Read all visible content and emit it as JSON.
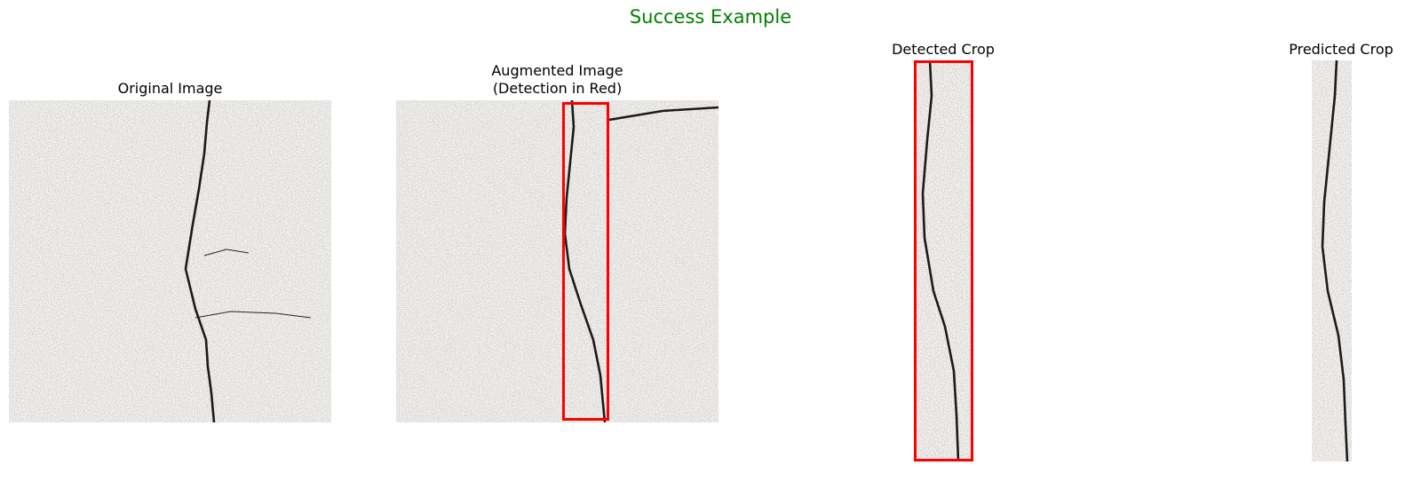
{
  "suptitle": "Success Example",
  "colors": {
    "suptitle": "#008000",
    "detection_box": "#ff0000",
    "concrete_base": "#9a9185",
    "crack": "#1e1a17"
  },
  "panels": [
    {
      "title": "Original Image",
      "content": "concrete surface with vertical crack"
    },
    {
      "title": "Augmented Image\n(Detection in Red)",
      "content": "augmented concrete surface with detection box"
    },
    {
      "title": "Detected Crop",
      "content": "cropped crack region with red border"
    },
    {
      "title": "Predicted Crop",
      "content": "predicted crop of crack region"
    }
  ]
}
